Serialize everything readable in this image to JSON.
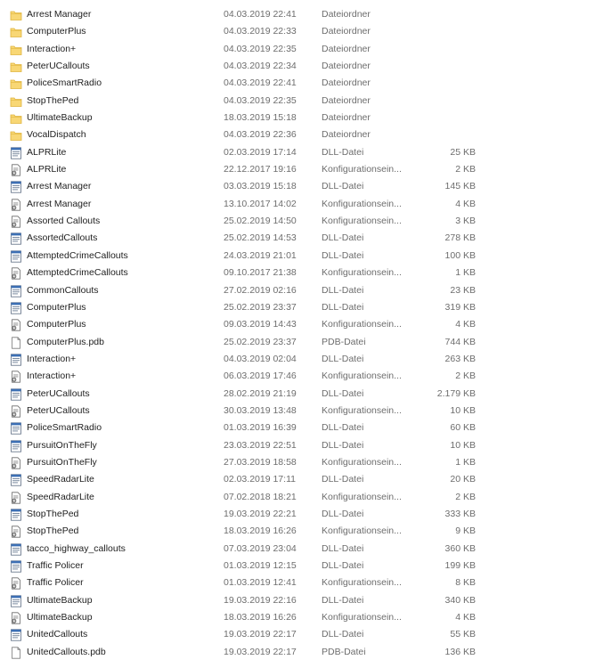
{
  "files": [
    {
      "name": "Arrest Manager",
      "date": "04.03.2019 22:41",
      "type": "Dateiordner",
      "size": "",
      "icon": "folder-icon"
    },
    {
      "name": "ComputerPlus",
      "date": "04.03.2019 22:33",
      "type": "Dateiordner",
      "size": "",
      "icon": "folder-icon"
    },
    {
      "name": "Interaction+",
      "date": "04.03.2019 22:35",
      "type": "Dateiordner",
      "size": "",
      "icon": "folder-icon"
    },
    {
      "name": "PeterUCallouts",
      "date": "04.03.2019 22:34",
      "type": "Dateiordner",
      "size": "",
      "icon": "folder-icon"
    },
    {
      "name": "PoliceSmartRadio",
      "date": "04.03.2019 22:41",
      "type": "Dateiordner",
      "size": "",
      "icon": "folder-icon"
    },
    {
      "name": "StopThePed",
      "date": "04.03.2019 22:35",
      "type": "Dateiordner",
      "size": "",
      "icon": "folder-icon"
    },
    {
      "name": "UltimateBackup",
      "date": "18.03.2019 15:18",
      "type": "Dateiordner",
      "size": "",
      "icon": "folder-icon"
    },
    {
      "name": "VocalDispatch",
      "date": "04.03.2019 22:36",
      "type": "Dateiordner",
      "size": "",
      "icon": "folder-icon"
    },
    {
      "name": "ALPRLite",
      "date": "02.03.2019 17:14",
      "type": "DLL-Datei",
      "size": "25 KB",
      "icon": "dll-file-icon"
    },
    {
      "name": "ALPRLite",
      "date": "22.12.2017 19:16",
      "type": "Konfigurationsein...",
      "size": "2 KB",
      "icon": "config-file-icon"
    },
    {
      "name": "Arrest Manager",
      "date": "03.03.2019 15:18",
      "type": "DLL-Datei",
      "size": "145 KB",
      "icon": "dll-file-icon"
    },
    {
      "name": "Arrest Manager",
      "date": "13.10.2017 14:02",
      "type": "Konfigurationsein...",
      "size": "4 KB",
      "icon": "config-file-icon"
    },
    {
      "name": "Assorted Callouts",
      "date": "25.02.2019 14:50",
      "type": "Konfigurationsein...",
      "size": "3 KB",
      "icon": "config-file-icon"
    },
    {
      "name": "AssortedCallouts",
      "date": "25.02.2019 14:53",
      "type": "DLL-Datei",
      "size": "278 KB",
      "icon": "dll-file-icon"
    },
    {
      "name": "AttemptedCrimeCallouts",
      "date": "24.03.2019 21:01",
      "type": "DLL-Datei",
      "size": "100 KB",
      "icon": "dll-file-icon"
    },
    {
      "name": "AttemptedCrimeCallouts",
      "date": "09.10.2017 21:38",
      "type": "Konfigurationsein...",
      "size": "1 KB",
      "icon": "config-file-icon"
    },
    {
      "name": "CommonCallouts",
      "date": "27.02.2019 02:16",
      "type": "DLL-Datei",
      "size": "23 KB",
      "icon": "dll-file-icon"
    },
    {
      "name": "ComputerPlus",
      "date": "25.02.2019 23:37",
      "type": "DLL-Datei",
      "size": "319 KB",
      "icon": "dll-file-icon"
    },
    {
      "name": "ComputerPlus",
      "date": "09.03.2019 14:43",
      "type": "Konfigurationsein...",
      "size": "4 KB",
      "icon": "config-file-icon"
    },
    {
      "name": "ComputerPlus.pdb",
      "date": "25.02.2019 23:37",
      "type": "PDB-Datei",
      "size": "744 KB",
      "icon": "blank-file-icon"
    },
    {
      "name": "Interaction+",
      "date": "04.03.2019 02:04",
      "type": "DLL-Datei",
      "size": "263 KB",
      "icon": "dll-file-icon"
    },
    {
      "name": "Interaction+",
      "date": "06.03.2019 17:46",
      "type": "Konfigurationsein...",
      "size": "2 KB",
      "icon": "config-file-icon"
    },
    {
      "name": "PeterUCallouts",
      "date": "28.02.2019 21:19",
      "type": "DLL-Datei",
      "size": "2.179 KB",
      "icon": "dll-file-icon"
    },
    {
      "name": "PeterUCallouts",
      "date": "30.03.2019 13:48",
      "type": "Konfigurationsein...",
      "size": "10 KB",
      "icon": "config-file-icon"
    },
    {
      "name": "PoliceSmartRadio",
      "date": "01.03.2019 16:39",
      "type": "DLL-Datei",
      "size": "60 KB",
      "icon": "dll-file-icon"
    },
    {
      "name": "PursuitOnTheFly",
      "date": "23.03.2019 22:51",
      "type": "DLL-Datei",
      "size": "10 KB",
      "icon": "dll-file-icon"
    },
    {
      "name": "PursuitOnTheFly",
      "date": "27.03.2019 18:58",
      "type": "Konfigurationsein...",
      "size": "1 KB",
      "icon": "config-file-icon"
    },
    {
      "name": "SpeedRadarLite",
      "date": "02.03.2019 17:11",
      "type": "DLL-Datei",
      "size": "20 KB",
      "icon": "dll-file-icon"
    },
    {
      "name": "SpeedRadarLite",
      "date": "07.02.2018 18:21",
      "type": "Konfigurationsein...",
      "size": "2 KB",
      "icon": "config-file-icon"
    },
    {
      "name": "StopThePed",
      "date": "19.03.2019 22:21",
      "type": "DLL-Datei",
      "size": "333 KB",
      "icon": "dll-file-icon"
    },
    {
      "name": "StopThePed",
      "date": "18.03.2019 16:26",
      "type": "Konfigurationsein...",
      "size": "9 KB",
      "icon": "config-file-icon"
    },
    {
      "name": "tacco_highway_callouts",
      "date": "07.03.2019 23:04",
      "type": "DLL-Datei",
      "size": "360 KB",
      "icon": "dll-file-icon"
    },
    {
      "name": "Traffic Policer",
      "date": "01.03.2019 12:15",
      "type": "DLL-Datei",
      "size": "199 KB",
      "icon": "dll-file-icon"
    },
    {
      "name": "Traffic Policer",
      "date": "01.03.2019 12:41",
      "type": "Konfigurationsein...",
      "size": "8 KB",
      "icon": "config-file-icon"
    },
    {
      "name": "UltimateBackup",
      "date": "19.03.2019 22:16",
      "type": "DLL-Datei",
      "size": "340 KB",
      "icon": "dll-file-icon"
    },
    {
      "name": "UltimateBackup",
      "date": "18.03.2019 16:26",
      "type": "Konfigurationsein...",
      "size": "4 KB",
      "icon": "config-file-icon"
    },
    {
      "name": "UnitedCallouts",
      "date": "19.03.2019 22:17",
      "type": "DLL-Datei",
      "size": "55 KB",
      "icon": "dll-file-icon"
    },
    {
      "name": "UnitedCallouts.pdb",
      "date": "19.03.2019 22:17",
      "type": "PDB-Datei",
      "size": "136 KB",
      "icon": "blank-file-icon"
    }
  ],
  "colors": {
    "folder": "#f8d775",
    "folder_dark": "#e0b43c",
    "dll_accent": "#3c6fb4",
    "text": "#1e1e1e",
    "meta_text": "#6d6d6d"
  }
}
